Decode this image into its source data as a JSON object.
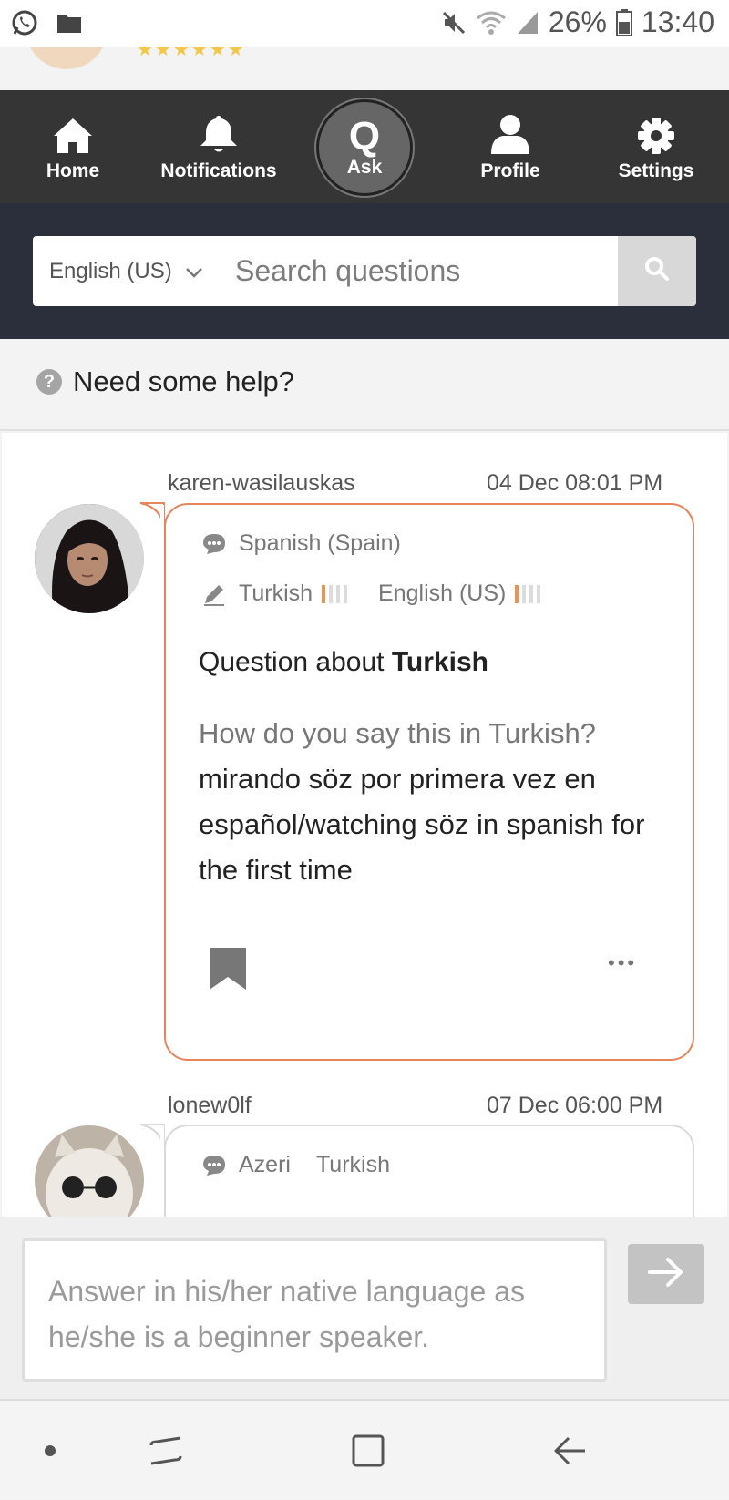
{
  "status_bar": {
    "battery": "26%",
    "time": "13:40"
  },
  "nav": {
    "home": "Home",
    "notifications": "Notifications",
    "ask": "Ask",
    "ask_glyph": "Q",
    "profile": "Profile",
    "settings": "Settings"
  },
  "search": {
    "language": "English (US)",
    "placeholder": "Search questions"
  },
  "help": {
    "icon_glyph": "?",
    "text": "Need some help?"
  },
  "questions": [
    {
      "user": "karen-wasilauskas",
      "date": "04 Dec 08:01 PM",
      "native_language": "Spanish (Spain)",
      "studying": [
        {
          "language": "Turkish",
          "level": 1
        },
        {
          "language": "English (US)",
          "level": 1
        }
      ],
      "title_prefix": "Question about",
      "title_language": "Turkish",
      "body_prompt": "How do you say this in Turkish?",
      "body_text": "mirando söz por primera vez en español/watching söz in spanish for the first time",
      "more_glyph": "•••"
    },
    {
      "user": "lonew0lf",
      "date": "07 Dec 06:00 PM",
      "native_language": "Azeri",
      "native_language_2": "Turkish"
    }
  ],
  "answer": {
    "placeholder": "Answer in his/her native language as he/she is a beginner speaker."
  },
  "colors": {
    "nav_bg": "#353535",
    "search_panel_bg": "#2b2f3b",
    "accent": "#e6845b",
    "level_on": "#f0924f"
  },
  "icons": [
    "whatsapp-icon",
    "folder-icon",
    "mute-icon",
    "wifi-icon",
    "signal-icon",
    "battery-icon",
    "home-icon",
    "bell-icon",
    "profile-icon",
    "gear-icon",
    "chevron-down-icon",
    "search-icon",
    "help-icon",
    "speech-bubble-icon",
    "pencil-icon",
    "bookmark-icon",
    "more-icon",
    "arrow-right-icon",
    "recent-apps-icon",
    "overview-icon",
    "back-icon"
  ]
}
